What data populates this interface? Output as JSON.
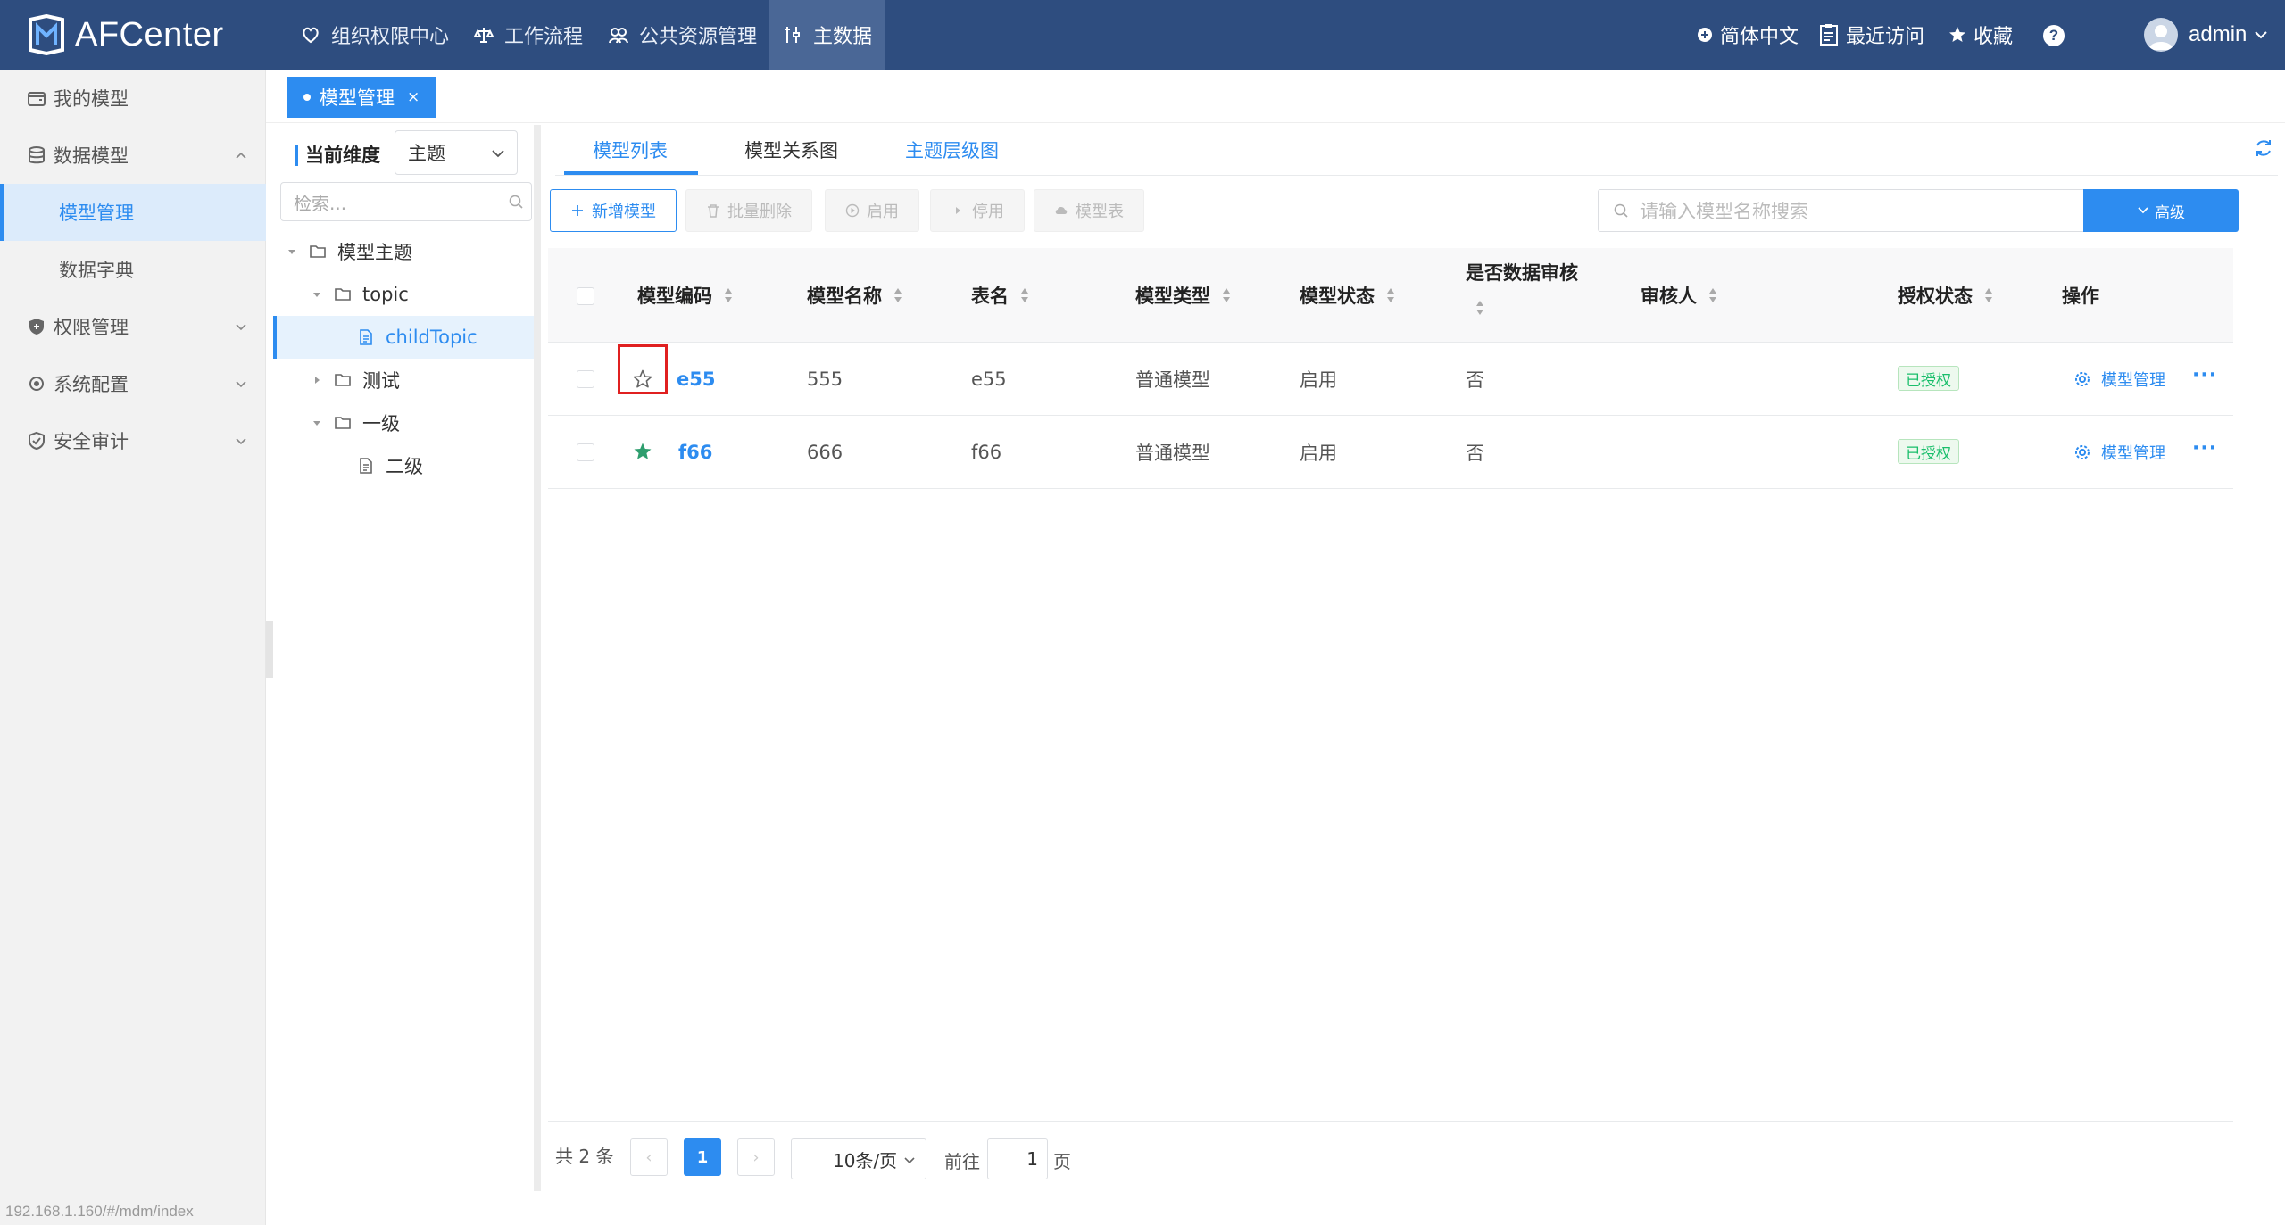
{
  "app": {
    "name": "AFCenter"
  },
  "topnav": [
    {
      "label": "组织权限中心",
      "icon": "heart-shield-icon"
    },
    {
      "label": "工作流程",
      "icon": "scale-icon"
    },
    {
      "label": "公共资源管理",
      "icon": "people-icon"
    },
    {
      "label": "主数据",
      "icon": "tools-icon",
      "active": true
    }
  ],
  "topright": {
    "language": "简体中文",
    "recent": "最近访问",
    "favorites": "收藏",
    "help": "?",
    "user": "admin"
  },
  "sidebar": {
    "items": [
      {
        "label": "我的模型",
        "icon": "wallet-icon"
      },
      {
        "label": "数据模型",
        "icon": "database-icon",
        "expanded": true
      },
      {
        "label": "模型管理",
        "sub": true,
        "active": true
      },
      {
        "label": "数据字典",
        "sub": true
      },
      {
        "label": "权限管理",
        "icon": "shield-icon"
      },
      {
        "label": "系统配置",
        "icon": "settings-icon"
      },
      {
        "label": "安全审计",
        "icon": "audit-shield-icon"
      }
    ],
    "status_url": "192.168.1.160/#/mdm/index"
  },
  "tabstrip": {
    "active_tab": "模型管理",
    "close": "×"
  },
  "tree": {
    "dimension_label": "当前维度",
    "dimension_value": "主题",
    "search_placeholder": "检索...",
    "nodes": [
      {
        "label": "模型主题",
        "type": "folder",
        "expanded": true
      },
      {
        "label": "topic",
        "type": "folder",
        "expanded": true
      },
      {
        "label": "childTopic",
        "type": "file",
        "selected": true
      },
      {
        "label": "测试",
        "type": "folder",
        "expanded": false
      },
      {
        "label": "一级",
        "type": "folder",
        "expanded": true
      },
      {
        "label": "二级",
        "type": "file"
      }
    ]
  },
  "content_tabs": [
    "模型列表",
    "模型关系图",
    "主题层级图"
  ],
  "toolbar": {
    "add": "新增模型",
    "batch_delete": "批量删除",
    "enable": "启用",
    "disable": "停用",
    "model_table": "模型表",
    "search_placeholder": "请输入模型名称搜索",
    "advanced": "高级"
  },
  "table": {
    "headers": [
      "模型编码",
      "模型名称",
      "表名",
      "模型类型",
      "模型状态",
      "是否数据审核",
      "审核人",
      "授权状态",
      "操作"
    ],
    "rows": [
      {
        "starred": false,
        "code": "e55",
        "name": "555",
        "table": "e55",
        "type": "普通模型",
        "status": "启用",
        "audit": "否",
        "reviewer": "",
        "auth": "已授权",
        "op": "模型管理",
        "more": "···"
      },
      {
        "starred": true,
        "code": "f66",
        "name": "666",
        "table": "f66",
        "type": "普通模型",
        "status": "启用",
        "audit": "否",
        "reviewer": "",
        "auth": "已授权",
        "op": "模型管理",
        "more": "···"
      }
    ]
  },
  "pagination": {
    "total": "共 2 条",
    "prev": "‹",
    "current": "1",
    "next": "›",
    "page_size": "10条/页",
    "goto_label": "前往",
    "goto_value": "1",
    "goto_suffix": "页"
  },
  "colors": {
    "topbar": "#2e4d7f",
    "accent": "#2d8cf0",
    "success": "#19be6b",
    "highlight": "#e02020"
  }
}
